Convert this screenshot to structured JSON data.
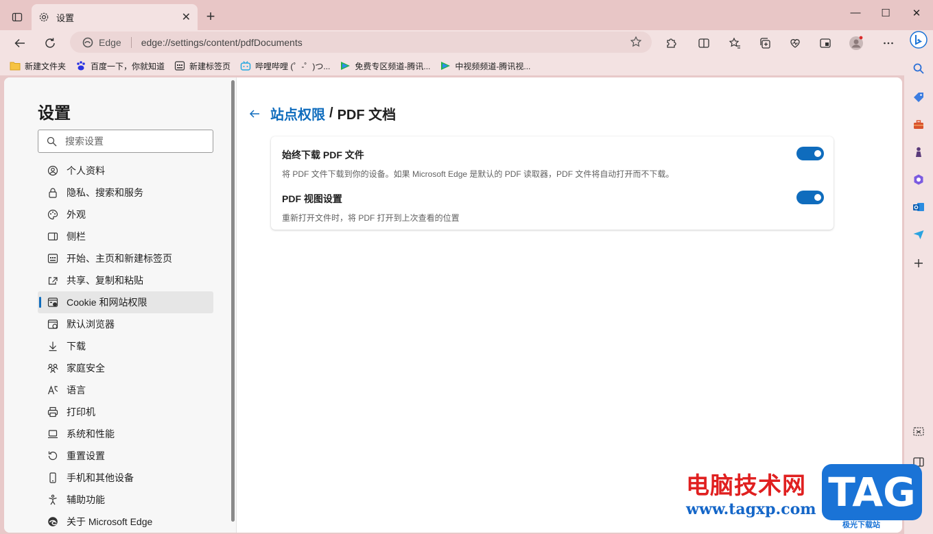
{
  "tab": {
    "title": "设置",
    "close": "✕"
  },
  "window_controls": {
    "minimize": "—",
    "maximize": "☐",
    "close": "✕"
  },
  "address": {
    "site": "Edge",
    "url": "edge://settings/content/pdfDocuments"
  },
  "bookmarks": [
    {
      "label": "新建文件夹",
      "icon": "folder-icon"
    },
    {
      "label": "百度一下，你就知道",
      "icon": "baidu-icon"
    },
    {
      "label": "新建标签页",
      "icon": "newtab-icon"
    },
    {
      "label": "哔哩哔哩 (゜-゜)つ...",
      "icon": "bilibili-icon"
    },
    {
      "label": "免费专区频道-腾讯...",
      "icon": "tencent-video-icon"
    },
    {
      "label": "中视频频道-腾讯视...",
      "icon": "tencent-video-icon"
    }
  ],
  "sidebar": {
    "title": "设置",
    "search_placeholder": "搜索设置",
    "items": [
      {
        "label": "个人资料",
        "icon": "profile-icon"
      },
      {
        "label": "隐私、搜索和服务",
        "icon": "lock-icon"
      },
      {
        "label": "外观",
        "icon": "palette-icon"
      },
      {
        "label": "侧栏",
        "icon": "sidebar-icon"
      },
      {
        "label": "开始、主页和新建标签页",
        "icon": "home-grid-icon"
      },
      {
        "label": "共享、复制和粘贴",
        "icon": "share-icon"
      },
      {
        "label": "Cookie 和网站权限",
        "icon": "cookie-icon",
        "active": true
      },
      {
        "label": "默认浏览器",
        "icon": "browser-icon"
      },
      {
        "label": "下载",
        "icon": "download-icon"
      },
      {
        "label": "家庭安全",
        "icon": "family-icon"
      },
      {
        "label": "语言",
        "icon": "language-icon"
      },
      {
        "label": "打印机",
        "icon": "printer-icon"
      },
      {
        "label": "系统和性能",
        "icon": "system-icon"
      },
      {
        "label": "重置设置",
        "icon": "reset-icon"
      },
      {
        "label": "手机和其他设备",
        "icon": "phone-icon"
      },
      {
        "label": "辅助功能",
        "icon": "accessibility-icon"
      },
      {
        "label": "关于 Microsoft Edge",
        "icon": "edge-icon"
      }
    ]
  },
  "main": {
    "breadcrumb_parent": "站点权限",
    "breadcrumb_sep": "/",
    "breadcrumb_current": "PDF 文档",
    "settings": [
      {
        "title": "始终下载 PDF 文件",
        "desc": "将 PDF 文件下载到你的设备。如果 Microsoft Edge 是默认的 PDF 读取器，PDF 文件将自动打开而不下载。",
        "enabled": true
      },
      {
        "title": "PDF 视图设置",
        "desc": "重新打开文件时，将 PDF 打开到上次查看的位置",
        "enabled": true
      }
    ]
  },
  "watermark": {
    "text": "电脑技术网",
    "url": "www.tagxp.com",
    "tag": "TAG",
    "sub": "极光下载站"
  },
  "colors": {
    "accent": "#0f6cbd",
    "frame": "#f3e2e2"
  }
}
